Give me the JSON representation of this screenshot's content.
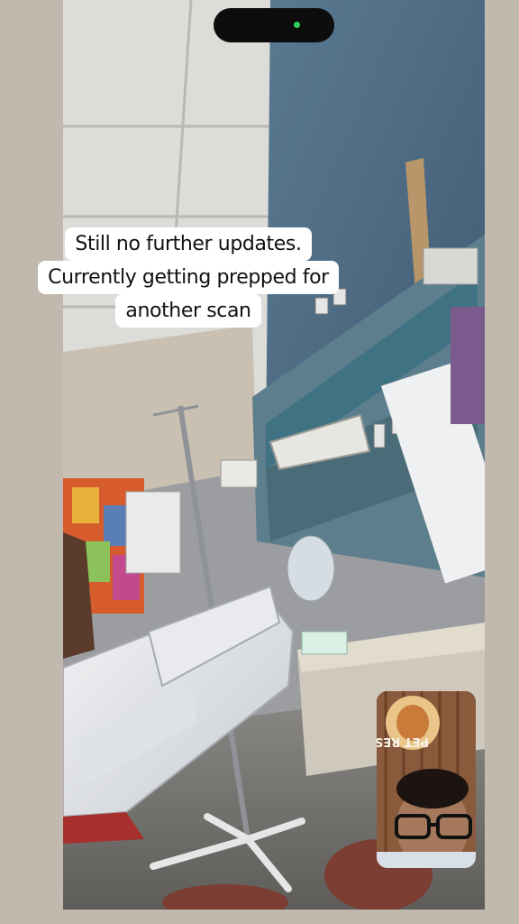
{
  "story": {
    "caption_lines": [
      "Still no further updates.",
      "Currently getting prepped for",
      "another scan"
    ]
  },
  "video": {
    "scene": "hospital room with bed and monitors",
    "pip": {
      "label": "self-view camera",
      "sign_text": "PET RES"
    }
  },
  "colors": {
    "island": "#0d0d0d",
    "camera_indicator": "#2ed158",
    "caption_bg": "#ffffff",
    "wall_blue": "#4d6b84",
    "ceiling": "#e4e4e0"
  }
}
